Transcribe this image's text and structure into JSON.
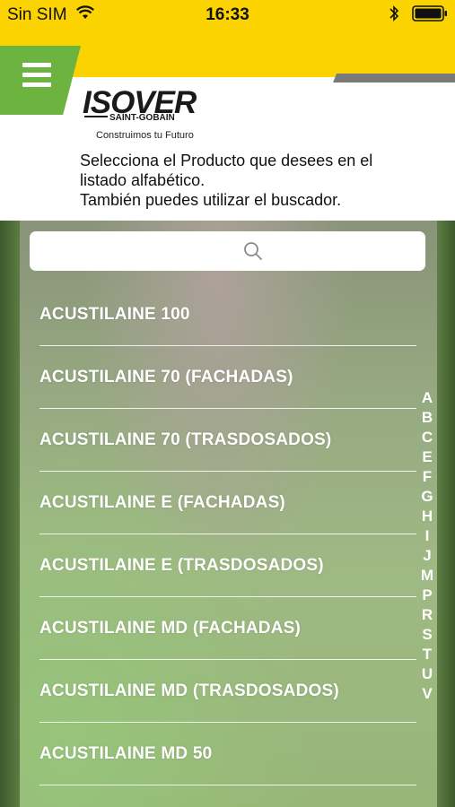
{
  "status": {
    "carrier": "Sin SIM",
    "time": "16:33"
  },
  "header": {
    "logo_text": "ISOVER",
    "logo_sub": "SAINT-GOBAIN",
    "tagline": "Construimos tu Futuro",
    "intro_lines": [
      "Selecciona el Producto que desees en el",
      "listado alfabético.",
      "También puedes utilizar el buscador."
    ]
  },
  "colors": {
    "yellow": "#fbd300",
    "green": "#6cb33f",
    "grey": "#7a7a7a"
  },
  "icons": {
    "menu": "hamburger-icon",
    "search": "search-icon",
    "wifi": "wifi-icon",
    "bluetooth": "bluetooth-icon",
    "battery": "battery-icon"
  },
  "products": [
    "ACUSTILAINE 100",
    "ACUSTILAINE 70 (FACHADAS)",
    "ACUSTILAINE 70 (TRASDOSADOS)",
    "ACUSTILAINE E (FACHADAS)",
    "ACUSTILAINE E (TRASDOSADOS)",
    "ACUSTILAINE MD (FACHADAS)",
    "ACUSTILAINE MD (TRASDOSADOS)",
    "ACUSTILAINE MD 50"
  ],
  "alphabet_index": [
    "A",
    "B",
    "C",
    "E",
    "F",
    "G",
    "H",
    "I",
    "J",
    "M",
    "P",
    "R",
    "S",
    "T",
    "U",
    "V"
  ]
}
